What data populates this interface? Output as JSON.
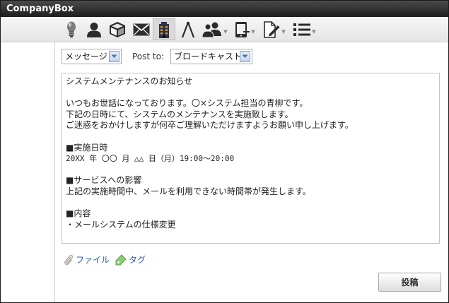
{
  "app": {
    "title": "CompanyBox"
  },
  "toolbar": {
    "icons": [
      "lightbulb-icon",
      "user-icon",
      "cube-icon",
      "mail-icon",
      "building-icon",
      "compass-icon",
      "group-icon",
      "phone-icon",
      "document-edit-icon",
      "list-icon"
    ],
    "active": "building-icon"
  },
  "compose": {
    "type_select": "メッセージ",
    "post_to_label": "Post to:",
    "post_to_select": "ブロードキャスト",
    "body_lines": [
      "システムメンテナンスのお知らせ",
      "",
      "いつもお世話になっております。〇×システム担当の青柳です。",
      "下記の日時にて、システムのメンテナンスを実施致します。",
      "ご迷惑をおかけしますが何卒ご理解いただけますようお願い申し上げます。",
      "",
      "■実施日時",
      "20XX 年 〇〇 月 △△ 日（月）19:00〜20:00",
      "",
      "■サービスへの影響",
      "上記の実施時間中、メールを利用できない時間帯が発生します。",
      "",
      "■内容",
      "・メールシステムの仕様変更"
    ],
    "file_link": "ファイル",
    "tag_link": "タグ",
    "post_button": "投稿"
  },
  "colors": {
    "titlebar": "#1e1e1e",
    "link": "#2b5fa8",
    "select_arrow": "#4a6ea9"
  }
}
